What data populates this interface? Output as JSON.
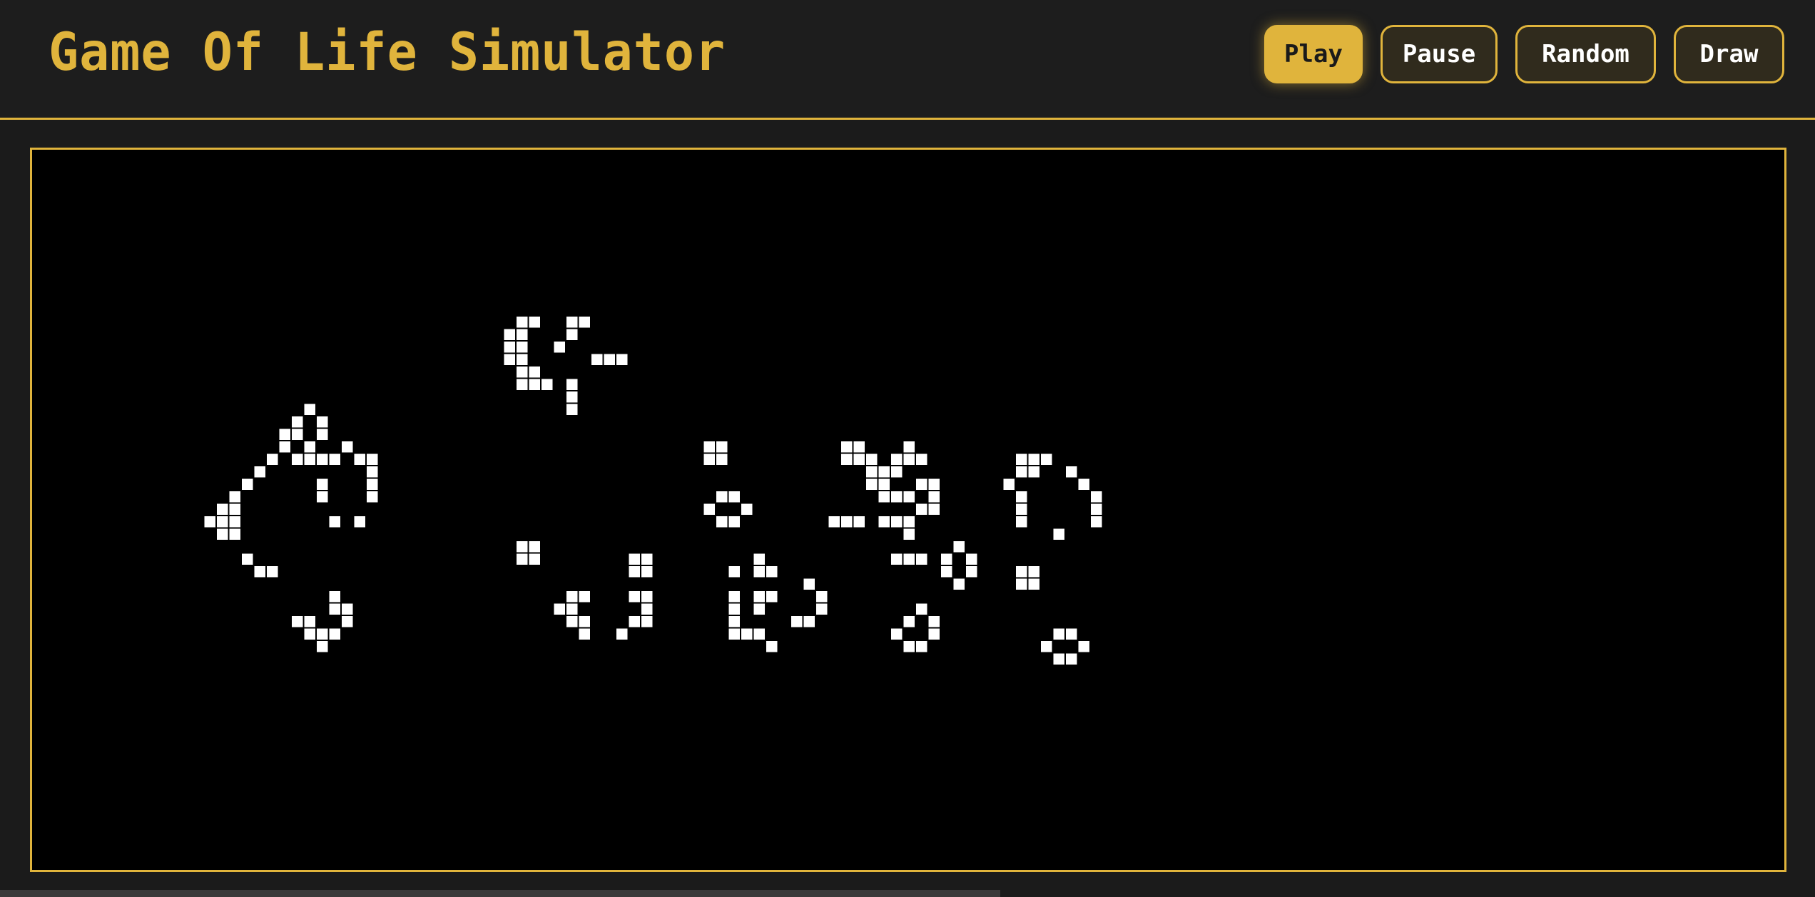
{
  "app": {
    "title": "Game Of Life Simulator"
  },
  "controls": {
    "play": "Play",
    "pause": "Pause",
    "random": "Random",
    "draw": "Draw",
    "active": "play"
  },
  "colors": {
    "accent": "#e0b43c",
    "background": "#1b1b1b",
    "board": "#000000",
    "cell_alive": "#ffffff"
  },
  "board": {
    "live_cells": [
      [
        20,
        6
      ],
      [
        21,
        6
      ],
      [
        24,
        6
      ],
      [
        25,
        6
      ],
      [
        19,
        7
      ],
      [
        20,
        7
      ],
      [
        24,
        7
      ],
      [
        19,
        8
      ],
      [
        20,
        8
      ],
      [
        23,
        8
      ],
      [
        19,
        9
      ],
      [
        20,
        9
      ],
      [
        26,
        9
      ],
      [
        27,
        9
      ],
      [
        28,
        9
      ],
      [
        20,
        10
      ],
      [
        21,
        10
      ],
      [
        20,
        11
      ],
      [
        21,
        11
      ],
      [
        22,
        11
      ],
      [
        24,
        11
      ],
      [
        24,
        12
      ],
      [
        24,
        13
      ],
      [
        3,
        13
      ],
      [
        2,
        14
      ],
      [
        4,
        14
      ],
      [
        1,
        15
      ],
      [
        2,
        15
      ],
      [
        4,
        15
      ],
      [
        1,
        16
      ],
      [
        3,
        16
      ],
      [
        6,
        16
      ],
      [
        0,
        17
      ],
      [
        2,
        17
      ],
      [
        3,
        17
      ],
      [
        4,
        17
      ],
      [
        5,
        17
      ],
      [
        7,
        17
      ],
      [
        8,
        17
      ],
      [
        -1,
        18
      ],
      [
        8,
        18
      ],
      [
        -2,
        19
      ],
      [
        4,
        19
      ],
      [
        8,
        19
      ],
      [
        -3,
        20
      ],
      [
        4,
        20
      ],
      [
        8,
        20
      ],
      [
        -4,
        21
      ],
      [
        -3,
        21
      ],
      [
        -5,
        22
      ],
      [
        -4,
        22
      ],
      [
        -3,
        22
      ],
      [
        5,
        22
      ],
      [
        7,
        22
      ],
      [
        -4,
        23
      ],
      [
        -3,
        23
      ],
      [
        -2,
        25
      ],
      [
        -1,
        26
      ],
      [
        0,
        26
      ],
      [
        5,
        28
      ],
      [
        5,
        29
      ],
      [
        6,
        29
      ],
      [
        2,
        30
      ],
      [
        3,
        30
      ],
      [
        6,
        30
      ],
      [
        3,
        31
      ],
      [
        4,
        31
      ],
      [
        5,
        31
      ],
      [
        4,
        32
      ],
      [
        35,
        16
      ],
      [
        36,
        16
      ],
      [
        35,
        17
      ],
      [
        36,
        17
      ],
      [
        36,
        20
      ],
      [
        37,
        20
      ],
      [
        35,
        21
      ],
      [
        38,
        21
      ],
      [
        36,
        22
      ],
      [
        37,
        22
      ],
      [
        46,
        16
      ],
      [
        47,
        16
      ],
      [
        51,
        16
      ],
      [
        46,
        17
      ],
      [
        47,
        17
      ],
      [
        48,
        17
      ],
      [
        50,
        17
      ],
      [
        51,
        17
      ],
      [
        52,
        17
      ],
      [
        48,
        18
      ],
      [
        49,
        18
      ],
      [
        50,
        18
      ],
      [
        48,
        19
      ],
      [
        49,
        19
      ],
      [
        52,
        19
      ],
      [
        53,
        19
      ],
      [
        49,
        20
      ],
      [
        50,
        20
      ],
      [
        51,
        20
      ],
      [
        53,
        20
      ],
      [
        52,
        21
      ],
      [
        53,
        21
      ],
      [
        45,
        22
      ],
      [
        46,
        22
      ],
      [
        47,
        22
      ],
      [
        49,
        22
      ],
      [
        50,
        22
      ],
      [
        51,
        22
      ],
      [
        51,
        23
      ],
      [
        50,
        25
      ],
      [
        51,
        25
      ],
      [
        52,
        25
      ],
      [
        55,
        24
      ],
      [
        54,
        25
      ],
      [
        56,
        25
      ],
      [
        54,
        26
      ],
      [
        56,
        26
      ],
      [
        55,
        27
      ],
      [
        60,
        17
      ],
      [
        61,
        17
      ],
      [
        62,
        17
      ],
      [
        60,
        18
      ],
      [
        61,
        18
      ],
      [
        64,
        18
      ],
      [
        59,
        19
      ],
      [
        65,
        19
      ],
      [
        60,
        20
      ],
      [
        66,
        20
      ],
      [
        60,
        21
      ],
      [
        66,
        21
      ],
      [
        60,
        22
      ],
      [
        66,
        22
      ],
      [
        63,
        23
      ],
      [
        60,
        26
      ],
      [
        61,
        26
      ],
      [
        60,
        27
      ],
      [
        61,
        27
      ],
      [
        20,
        24
      ],
      [
        21,
        24
      ],
      [
        20,
        25
      ],
      [
        21,
        25
      ],
      [
        29,
        25
      ],
      [
        30,
        25
      ],
      [
        29,
        26
      ],
      [
        30,
        26
      ],
      [
        24,
        28
      ],
      [
        25,
        28
      ],
      [
        29,
        28
      ],
      [
        30,
        28
      ],
      [
        23,
        29
      ],
      [
        24,
        29
      ],
      [
        30,
        29
      ],
      [
        24,
        30
      ],
      [
        25,
        30
      ],
      [
        29,
        30
      ],
      [
        30,
        30
      ],
      [
        25,
        31
      ],
      [
        28,
        31
      ],
      [
        39,
        25
      ],
      [
        37,
        26
      ],
      [
        39,
        26
      ],
      [
        40,
        26
      ],
      [
        43,
        27
      ],
      [
        39,
        28
      ],
      [
        40,
        28
      ],
      [
        44,
        28
      ],
      [
        39,
        29
      ],
      [
        44,
        29
      ],
      [
        42,
        30
      ],
      [
        43,
        30
      ],
      [
        37,
        31
      ],
      [
        38,
        31
      ],
      [
        39,
        31
      ],
      [
        40,
        32
      ],
      [
        37,
        28
      ],
      [
        37,
        29
      ],
      [
        37,
        30
      ],
      [
        52,
        29
      ],
      [
        51,
        30
      ],
      [
        53,
        30
      ],
      [
        50,
        31
      ],
      [
        53,
        31
      ],
      [
        51,
        32
      ],
      [
        52,
        32
      ],
      [
        63,
        31
      ],
      [
        64,
        31
      ],
      [
        62,
        32
      ],
      [
        65,
        32
      ],
      [
        63,
        33
      ],
      [
        64,
        33
      ]
    ]
  }
}
